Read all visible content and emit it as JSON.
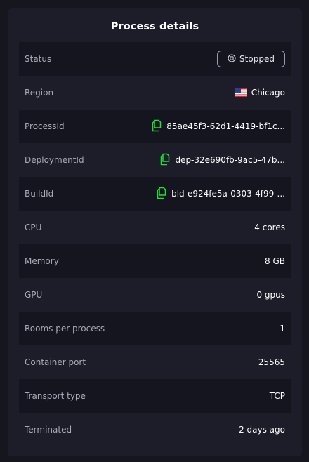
{
  "title": "Process details",
  "rows": [
    {
      "label": "Status",
      "value": "Stopped"
    },
    {
      "label": "Region",
      "value": "Chicago"
    },
    {
      "label": "ProcessId",
      "value": "85ae45f3-62d1-4419-bf1c..."
    },
    {
      "label": "DeploymentId",
      "value": "dep-32e690fb-9ac5-47b..."
    },
    {
      "label": "BuildId",
      "value": "bld-e924fe5a-0303-4f99-..."
    },
    {
      "label": "CPU",
      "value": "4 cores"
    },
    {
      "label": "Memory",
      "value": "8 GB"
    },
    {
      "label": "GPU",
      "value": "0 gpus"
    },
    {
      "label": "Rooms per process",
      "value": "1"
    },
    {
      "label": "Container port",
      "value": "25565"
    },
    {
      "label": "Transport type",
      "value": "TCP"
    },
    {
      "label": "Terminated",
      "value": "2 days ago"
    }
  ],
  "icons": {
    "status": "stop-circle-icon",
    "region": "us-flag-icon",
    "copy": "copy-icon"
  },
  "colors": {
    "accent": "#22e03a",
    "panel": "#1d1d29",
    "stripe": "#15151f"
  }
}
